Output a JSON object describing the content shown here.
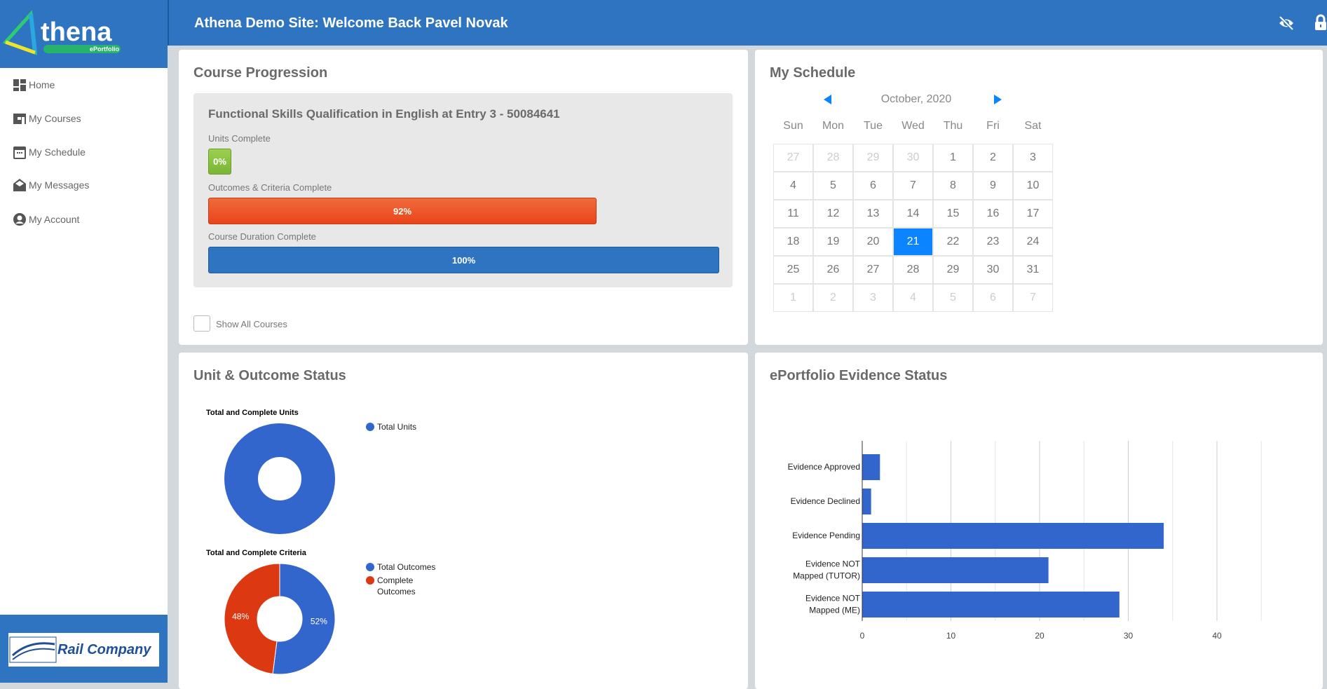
{
  "header": {
    "title": "Athena Demo Site: Welcome Back Pavel Novak",
    "icons": [
      "eye-slash-icon",
      "lock-icon"
    ]
  },
  "logo": {
    "text": "thena",
    "sub": "ePortfolio"
  },
  "sidebar": {
    "items": [
      {
        "label": "Home",
        "icon": "dashboard-icon"
      },
      {
        "label": "My Courses",
        "icon": "courses-icon"
      },
      {
        "label": "My Schedule",
        "icon": "calendar-icon"
      },
      {
        "label": "My Messages",
        "icon": "envelope-icon"
      },
      {
        "label": "My Account",
        "icon": "user-circle-icon"
      }
    ],
    "company": "Rail Company"
  },
  "progression": {
    "title": "Course Progression",
    "course": "Functional Skills Qualification in English at Entry 3 - 50084641",
    "units_label": "Units Complete",
    "units_value": "0%",
    "units_pct": 0,
    "outcomes_label": "Outcomes & Criteria Complete",
    "outcomes_value": "92%",
    "outcomes_pct": 92,
    "duration_label": "Course Duration Complete",
    "duration_value": "100%",
    "duration_pct": 100,
    "show_all": "Show All Courses",
    "colors": {
      "units": "#8cc63f",
      "outcomes": "#ee5322",
      "duration": "#2e74c0"
    }
  },
  "schedule": {
    "title": "My Schedule",
    "month": "October, 2020",
    "days": [
      "Sun",
      "Mon",
      "Tue",
      "Wed",
      "Thu",
      "Fri",
      "Sat"
    ],
    "cells": [
      "27",
      "28",
      "29",
      "30",
      "1",
      "2",
      "3",
      "4",
      "5",
      "6",
      "7",
      "8",
      "9",
      "10",
      "11",
      "12",
      "13",
      "14",
      "15",
      "16",
      "17",
      "18",
      "19",
      "20",
      "21",
      "22",
      "23",
      "24",
      "25",
      "26",
      "27",
      "28",
      "29",
      "30",
      "31",
      "1",
      "2",
      "3",
      "4",
      "5",
      "6",
      "7"
    ],
    "selected": "21",
    "accent": "#0a84ff"
  },
  "unit_status": {
    "title": "Unit & Outcome Status"
  },
  "evidence": {
    "title": "ePortfolio Evidence Status"
  },
  "chart_data": [
    {
      "type": "pie",
      "title": "Total and Complete Units",
      "donut": true,
      "labels": [
        "Total Units"
      ],
      "values": [
        100
      ],
      "colors": [
        "#3366cc"
      ],
      "legend": "right"
    },
    {
      "type": "pie",
      "title": "Total and Complete Criteria",
      "donut": true,
      "labels": [
        "Total Outcomes",
        "Complete Outcomes"
      ],
      "values": [
        52,
        48
      ],
      "slice_labels": [
        "52%",
        "48%"
      ],
      "colors": [
        "#3366cc",
        "#dc3912"
      ],
      "legend": "right"
    },
    {
      "type": "bar",
      "orientation": "horizontal",
      "categories": [
        "Evidence Approved",
        "Evidence Declined",
        "Evidence Pending",
        "Evidence NOT Mapped (TUTOR)",
        "Evidence NOT Mapped (ME)"
      ],
      "category_lines": [
        [
          "Evidence Approved"
        ],
        [
          "Evidence Declined"
        ],
        [
          "Evidence Pending"
        ],
        [
          "Evidence NOT",
          "Mapped (TUTOR)"
        ],
        [
          "Evidence NOT",
          "Mapped (ME)"
        ]
      ],
      "values": [
        2,
        1,
        34,
        21,
        29
      ],
      "xlim": [
        0,
        45
      ],
      "xticks": [
        "0",
        "10",
        "20",
        "30",
        "40"
      ],
      "grid": true,
      "color": "#3366cc"
    }
  ]
}
